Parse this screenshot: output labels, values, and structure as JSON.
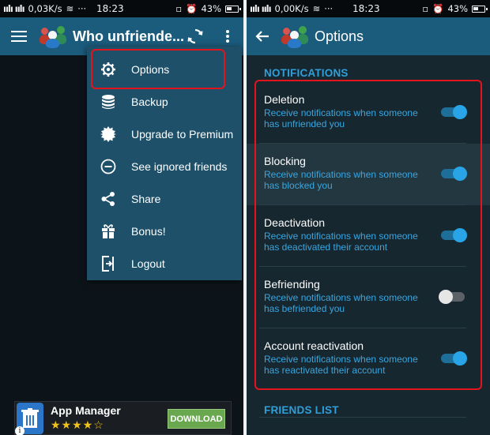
{
  "left": {
    "status": {
      "signal": "ıılı ıılı",
      "net": "0,03K/s",
      "time": "18:23",
      "battery": "43%",
      "dots": "···"
    },
    "app_title": "Who unfriende...",
    "menu": [
      {
        "label": "Options",
        "icon": "gear-icon"
      },
      {
        "label": "Backup",
        "icon": "database-icon"
      },
      {
        "label": "Upgrade to Premium",
        "icon": "badge-icon"
      },
      {
        "label": "See ignored friends",
        "icon": "minus-circle-icon"
      },
      {
        "label": "Share",
        "icon": "share-icon"
      },
      {
        "label": "Bonus!",
        "icon": "gift-icon"
      },
      {
        "label": "Logout",
        "icon": "logout-icon"
      }
    ],
    "ad": {
      "title": "App Manager",
      "stars": "★★★★☆",
      "button": "DOWNLOAD",
      "info": "i"
    }
  },
  "right": {
    "status": {
      "signal": "ıılı ıılı",
      "net": "0,00K/s",
      "time": "18:23",
      "battery": "43%",
      "dots": "···"
    },
    "app_title": "Options",
    "notifications_header": "NOTIFICATIONS",
    "options": [
      {
        "title": "Deletion",
        "desc": "Receive notifications when someone has unfriended you",
        "enabled": true
      },
      {
        "title": "Blocking",
        "desc": "Receive notifications when someone has blocked you",
        "enabled": true
      },
      {
        "title": "Deactivation",
        "desc": "Receive notifications when someone has deactivated their account",
        "enabled": true
      },
      {
        "title": "Befriending",
        "desc": "Receive notifications when someone has befriended you",
        "enabled": false
      },
      {
        "title": "Account reactivation",
        "desc": "Receive notifications when someone has reactivated their account",
        "enabled": true
      }
    ],
    "friends_list_header": "FRIENDS LIST"
  },
  "colors": {
    "appbar": "#1b5b7c",
    "accent": "#2f9fd9",
    "highlight_border": "#e2141e",
    "menu_bg": "#1e506a"
  }
}
